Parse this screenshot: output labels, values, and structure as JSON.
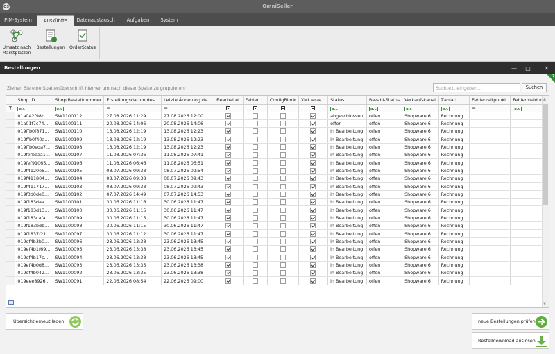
{
  "app": {
    "name": "OmniSeller",
    "logo_text": "OS"
  },
  "menu": {
    "tabs": [
      "PIM-System",
      "Auskünfte",
      "Datenaustausch",
      "Aufgaben",
      "System"
    ],
    "active_index": 1
  },
  "ribbon": {
    "buttons": [
      {
        "label_line1": "Umsatz nach",
        "label_line2": "Marktplätzen",
        "icon": "sales-chart-icon"
      },
      {
        "label_line1": "Bestellungen",
        "label_line2": "",
        "icon": "orders-icon"
      },
      {
        "label_line1": "OrderStatus",
        "label_line2": "",
        "icon": "order-status-icon"
      }
    ]
  },
  "window": {
    "title": "Bestellungen",
    "controls": {
      "minimize": "—",
      "maximize": "□",
      "close": "✕"
    },
    "help_badge": "?",
    "group_hint": "Ziehen Sie eine Spaltenüberschrift hierher um nach dieser Spalte zu gruppieren",
    "search": {
      "placeholder": "Suchtext eingeben...",
      "button_label": "Suchen"
    }
  },
  "grid": {
    "columns": [
      "Shop ID",
      "Shop Bestellnummer",
      "Erstellungsdatum des...",
      "Letzte Änderung de...",
      "Bearbeitet",
      "Fehler",
      "ConfigBlock",
      "XML erze...",
      "Status",
      "Bezahl-Status",
      "Verkaufskanal",
      "Zahlart",
      "Fehlerzeitpunkt",
      "Fehlermeldung"
    ],
    "filter_types": [
      "abc",
      "abc",
      "eq",
      "eq",
      "chk",
      "chk",
      "chk",
      "chk",
      "abc",
      "abc",
      "abc",
      "abc",
      "eq",
      "abc"
    ],
    "rows": [
      [
        "01a042f98b...",
        "SW1100112",
        "27.08.2026 11:29",
        "27.08.2026 12:00",
        true,
        false,
        false,
        true,
        "abgeschlossen",
        "offen",
        "Shopware 6",
        "Rechnung",
        "",
        ""
      ],
      [
        "01a01f7c74...",
        "SW1100111",
        "20.08.2026 14:06",
        "20.08.2026 14:06",
        true,
        false,
        false,
        true,
        "offen",
        "offen",
        "Shopware 6",
        "Rechnung",
        "",
        ""
      ],
      [
        "019ffb0f871...",
        "SW1100110",
        "13.08.2026 12:19",
        "13.08.2026 12:23",
        true,
        false,
        false,
        true,
        "in Bearbeitung",
        "offen",
        "Shopware 6",
        "Rechnung",
        "",
        ""
      ],
      [
        "019ffb0f40a...",
        "SW1100109",
        "13.08.2026 12:19",
        "13.08.2026 12:23",
        true,
        false,
        false,
        true,
        "in Bearbeitung",
        "offen",
        "Shopware 6",
        "Rechnung",
        "",
        ""
      ],
      [
        "019ffb0eda7...",
        "SW1100108",
        "13.08.2026 12:19",
        "13.08.2026 12:23",
        true,
        false,
        false,
        true,
        "in Bearbeitung",
        "offen",
        "Shopware 6",
        "Rechnung",
        "",
        ""
      ],
      [
        "019fefbeaa1...",
        "SW1100107",
        "11.08.2026 07:36",
        "11.08.2026 07:41",
        true,
        false,
        false,
        true,
        "in Bearbeitung",
        "offen",
        "Shopware 6",
        "Rechnung",
        "",
        ""
      ],
      [
        "019fef91065...",
        "SW1100106",
        "11.08.2026 06:46",
        "11.08.2026 06:51",
        true,
        false,
        false,
        true,
        "in Bearbeitung",
        "offen",
        "Shopware 6",
        "Rechnung",
        "",
        ""
      ],
      [
        "019f4120e6...",
        "SW1100105",
        "08.07.2026 09:38",
        "08.07.2026 09:54",
        true,
        false,
        false,
        true,
        "in Bearbeitung",
        "offen",
        "Shopware 6",
        "Rechnung",
        "",
        ""
      ],
      [
        "019f411804...",
        "SW1100104",
        "08.07.2026 09:38",
        "08.07.2026 09:43",
        true,
        false,
        false,
        true,
        "in Bearbeitung",
        "offen",
        "Shopware 6",
        "Rechnung",
        "",
        ""
      ],
      [
        "019f411717...",
        "SW1100103",
        "08.07.2026 09:38",
        "08.07.2026 09:43",
        true,
        false,
        false,
        true,
        "in Bearbeitung",
        "offen",
        "Shopware 6",
        "Rechnung",
        "",
        ""
      ],
      [
        "019f3d0de0...",
        "SW1100102",
        "07.07.2026 14:49",
        "07.07.2026 14:53",
        true,
        false,
        false,
        true,
        "in Bearbeitung",
        "offen",
        "Shopware 6",
        "Rechnung",
        "",
        ""
      ],
      [
        "019f183daa...",
        "SW1100101",
        "30.06.2026 11:16",
        "30.06.2026 11:47",
        true,
        false,
        false,
        true,
        "in Bearbeitung",
        "offen",
        "Shopware 6",
        "Rechnung",
        "",
        ""
      ],
      [
        "019f183d13...",
        "SW1100100",
        "30.06.2026 11:15",
        "30.06.2026 11:47",
        true,
        false,
        false,
        true,
        "in Bearbeitung",
        "offen",
        "Shopware 6",
        "Rechnung",
        "",
        ""
      ],
      [
        "019f183cafa...",
        "SW1100099",
        "30.06.2026 11:15",
        "30.06.2026 11:47",
        true,
        false,
        false,
        true,
        "in Bearbeitung",
        "offen",
        "Shopware 6",
        "Rechnung",
        "",
        ""
      ],
      [
        "019f183bdb...",
        "SW1100098",
        "30.06.2026 11:15",
        "30.06.2026 11:47",
        true,
        false,
        false,
        true,
        "in Bearbeitung",
        "offen",
        "Shopware 6",
        "Rechnung",
        "",
        ""
      ],
      [
        "019f1837f21...",
        "SW1100097",
        "30.06.2026 11:12",
        "30.06.2026 11:47",
        true,
        false,
        false,
        true,
        "in Bearbeitung",
        "offen",
        "Shopware 6",
        "Rechnung",
        "",
        ""
      ],
      [
        "019ef4b3b0...",
        "SW1100096",
        "23.06.2026 13:38",
        "23.06.2026 13:45",
        true,
        false,
        false,
        true,
        "in Bearbeitung",
        "offen",
        "Shopware 6",
        "Rechnung",
        "",
        ""
      ],
      [
        "019ef4b1f69...",
        "SW1100095",
        "23.06.2026 13:38",
        "23.06.2026 13:45",
        true,
        false,
        false,
        true,
        "in Bearbeitung",
        "offen",
        "Shopware 6",
        "Rechnung",
        "",
        ""
      ],
      [
        "019ef4b17c...",
        "SW1100094",
        "23.06.2026 13:38",
        "23.06.2026 13:45",
        true,
        false,
        false,
        true,
        "in Bearbeitung",
        "offen",
        "Shopware 6",
        "Rechnung",
        "",
        ""
      ],
      [
        "019ef4b0d8...",
        "SW1100093",
        "23.06.2026 13:35",
        "23.06.2026 13:38",
        true,
        false,
        false,
        true,
        "in Bearbeitung",
        "offen",
        "Shopware 6",
        "Rechnung",
        "",
        ""
      ],
      [
        "019ef4b042...",
        "SW1100092",
        "23.06.2026 13:35",
        "23.06.2026 13:38",
        true,
        false,
        false,
        true,
        "in Bearbeitung",
        "offen",
        "Shopware 6",
        "Rechnung",
        "",
        ""
      ],
      [
        "019eee8926...",
        "SW1100091",
        "22.06.2026 08:54",
        "22.06.2026 09:00",
        true,
        false,
        false,
        true,
        "in Bearbeitung",
        "offen",
        "Shopware 6",
        "Rechnung",
        "",
        ""
      ]
    ]
  },
  "footer": {
    "reload_label": "Übersicht erneut laden",
    "check_label": "neue Bestellungen prüfen",
    "download_label": "Bestelldownload auslösen"
  },
  "colors": {
    "accent_green": "#2d8b3a",
    "title_bar": "#5d5d5d",
    "window_header": "#2e2e2e"
  }
}
